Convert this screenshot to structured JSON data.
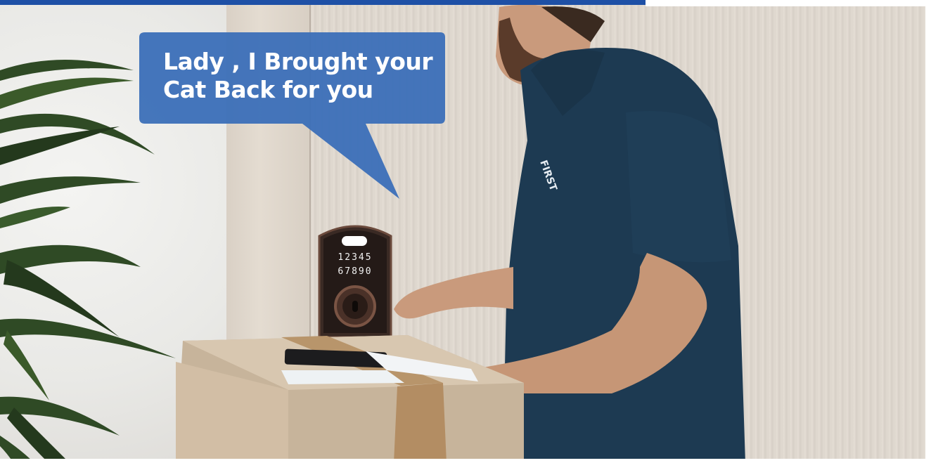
{
  "speech_bubble": {
    "line1": "Lady , I Brought your",
    "line2": "Cat Back for you",
    "color": "#3b6fb8"
  },
  "keypad": {
    "row1": "12345",
    "row2": "67890"
  },
  "colors": {
    "accent_bar": "#1e50a6",
    "shirt": "#1d3a52",
    "door": "#ddd6cd",
    "lock_finish": "#3a2a24"
  }
}
